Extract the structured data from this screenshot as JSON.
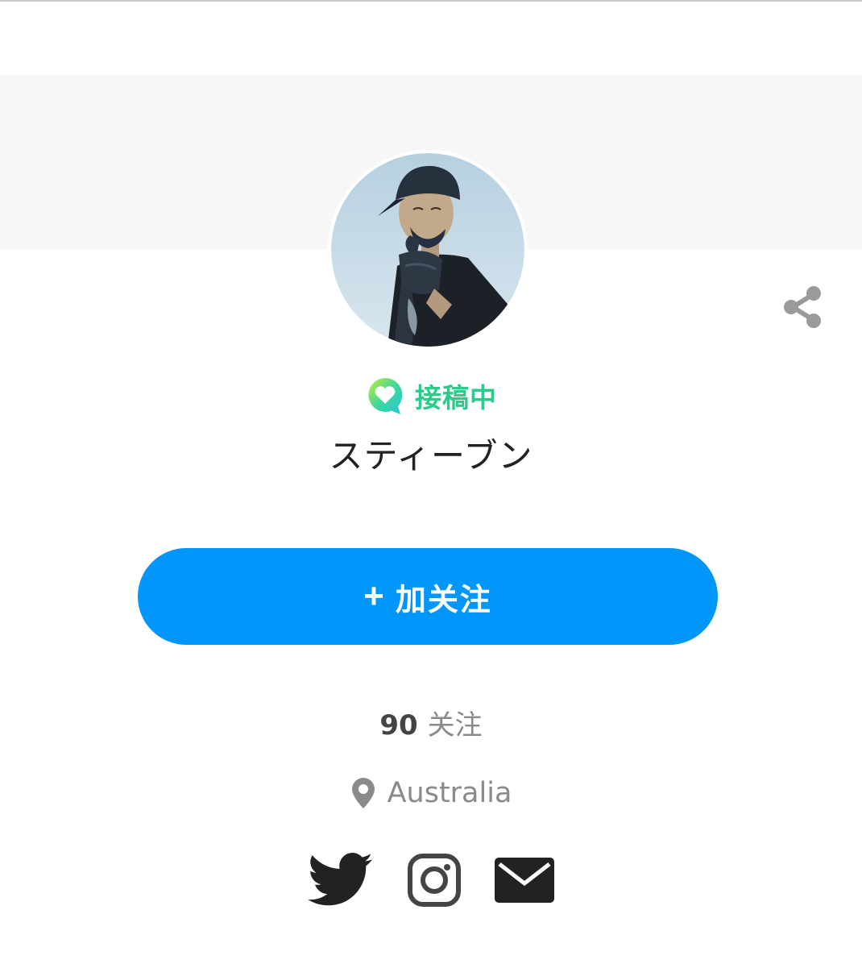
{
  "profile": {
    "status_label": "接稿中",
    "name": "スティーブン",
    "follow_button": {
      "plus": "+",
      "label": "加关注"
    },
    "following": {
      "count": "90",
      "label": "关注"
    },
    "location": "Australia"
  },
  "icons": {
    "share": "share-icon",
    "status": "speech-bubble-heart-icon",
    "location": "map-pin-icon",
    "social": [
      "twitter-icon",
      "instagram-icon",
      "mail-icon"
    ]
  },
  "colors": {
    "accent_blue": "#0096fa",
    "status_green": "#2bcc8a",
    "cover_gray": "#f7f7f7",
    "text_dark": "#222222",
    "text_gray": "#8a8a8a",
    "icon_gray": "#9a9a9a"
  }
}
